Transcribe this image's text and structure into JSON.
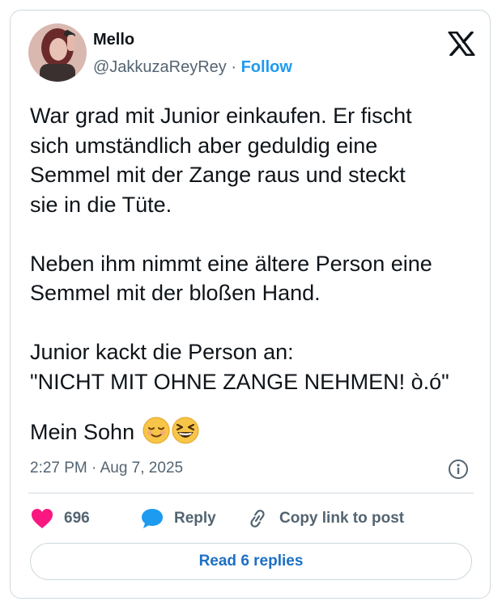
{
  "author": {
    "display_name": "Mello",
    "handle": "@JakkuzaReyRey",
    "separator": " · ",
    "follow_label": "Follow"
  },
  "tweet": {
    "text": "War grad mit Junior einkaufen. Er fischt\nsich umständlich aber geduldig eine\nSemmel mit der Zange raus und steckt\nsie in die Tüte.\n\nNeben ihm nimmt eine ältere Person eine\nSemmel mit der bloßen Hand.\n\nJunior kackt die Person an:\n\"NICHT MIT OHNE ZANGE NEHMEN! ò.ó\"",
    "last_line": "Mein Sohn ",
    "emojis": [
      "relieved-face-emoji",
      "grinning-squinting-face-emoji"
    ],
    "timestamp": "2:27 PM · Aug 7, 2025"
  },
  "actions": {
    "likes": "696",
    "reply_label": "Reply",
    "copy_link_label": "Copy link to post"
  },
  "read_replies_label": "Read 6 replies",
  "colors": {
    "text": "#0f1419",
    "secondary": "#536471",
    "link": "#1d9bf0",
    "like": "#f91880",
    "reply": "#1d9bf0",
    "border": "#cfd9de"
  }
}
